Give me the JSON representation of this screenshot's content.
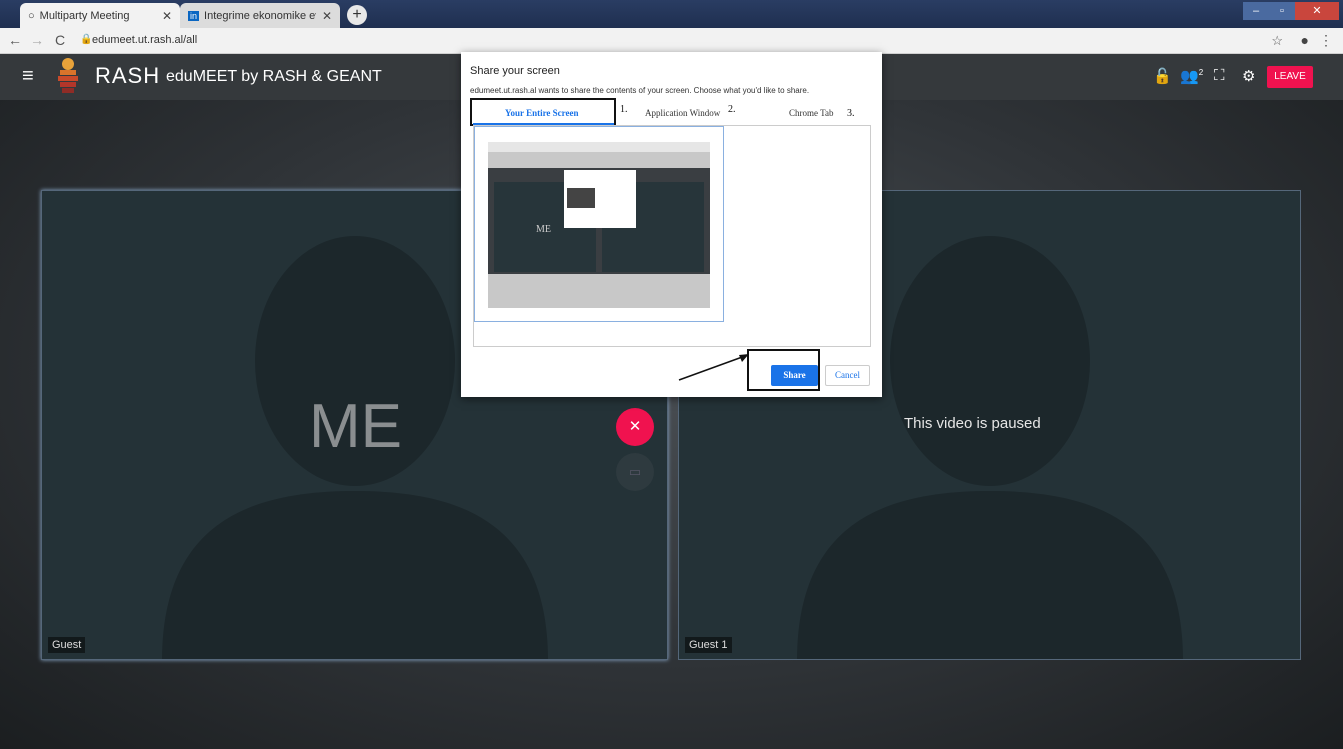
{
  "browser": {
    "tabs": [
      {
        "title": "Multiparty Meeting",
        "icon": "chat-icon"
      },
      {
        "title": "Integrime ekonomike evropiane",
        "icon": "linkedin-icon"
      }
    ],
    "url": "edumeet.ut.rash.al/all",
    "new_tab": "+"
  },
  "app": {
    "brand": "RASH",
    "title": "eduMEET by RASH & GEANT",
    "participants_badge": "2",
    "leave_label": "LEAVE",
    "colors": {
      "accent": "#f0124f",
      "primary": "#1a73e8"
    }
  },
  "videos": {
    "me": {
      "overlay": "ME",
      "label": "Guest"
    },
    "guest1": {
      "overlay": "This video is paused",
      "label": "Guest 1"
    }
  },
  "dialog": {
    "title": "Share your screen",
    "description": "edumeet.ut.rash.al wants to share the contents of your screen. Choose what you'd like to share.",
    "tabs": [
      {
        "label": "Your Entire Screen",
        "annotation": "1."
      },
      {
        "label": "Application Window",
        "annotation": "2."
      },
      {
        "label": "Chrome Tab",
        "annotation": "3."
      }
    ],
    "thumb_overlay": "ME",
    "share_label": "Share",
    "cancel_label": "Cancel"
  }
}
